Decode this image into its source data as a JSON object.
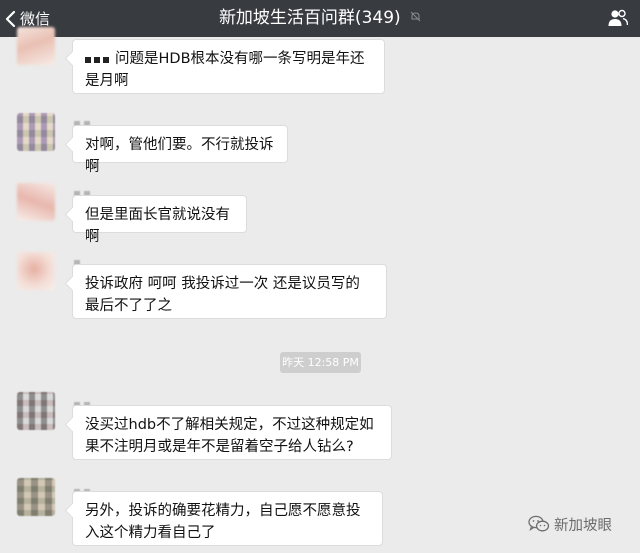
{
  "navbar": {
    "back_label": "微信",
    "title": "新加坡生活百问群(349)",
    "right_icon": "people-icon",
    "mute_icon": "mute-bell-icon"
  },
  "messages": [
    {
      "id": "m1",
      "text": "问题是HDB根本没有哪一条写明是年还是月啊"
    },
    {
      "id": "m2",
      "text": "对啊，管他们要。不行就投诉啊"
    },
    {
      "id": "m3",
      "text": "但是里面长官就说没有啊"
    },
    {
      "id": "m4",
      "text": "投诉政府 呵呵 我投诉过一次 还是议员写的 最后不了了之"
    },
    {
      "id": "m5",
      "text": "没买过hdb不了解相关规定，不过这种规定如果不注明月或是年不是留着空子给人钻么?"
    },
    {
      "id": "m6",
      "text": "另外，投诉的确要花精力，自己愿不愿意投入这个精力看自己了"
    }
  ],
  "timestamp": "昨天 12:58 PM",
  "watermark": "新加坡眼",
  "colors": {
    "navbar_bg": "#383b40",
    "chat_bg": "#ebebeb",
    "bubble_bg": "#ffffff",
    "timestamp_bg": "#cecece"
  }
}
